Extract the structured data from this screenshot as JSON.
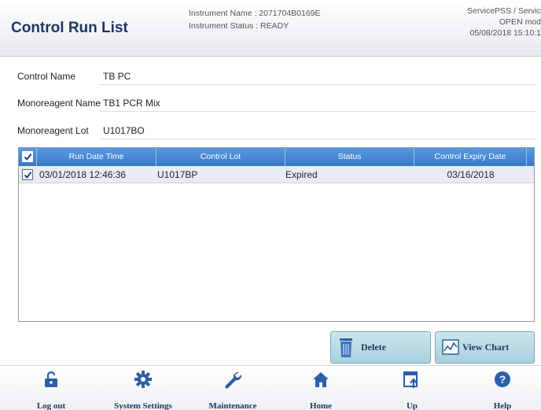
{
  "header": {
    "title": "Control Run List",
    "instrument_name": "Instrument Name : 2071704B0169E",
    "instrument_status": "Instrument Status : READY",
    "user": "ServicePSS / Servic",
    "mode": "OPEN mod",
    "datetime": "05/08/2018 15:10:1"
  },
  "fields": {
    "control_name_label": "Control Name",
    "control_name_value": "TB PC",
    "monoreagent_name_label": "Monoreagent Name",
    "monoreagent_name_value": "TB1 PCR Mix",
    "monoreagent_lot_label": "Monoreagent Lot",
    "monoreagent_lot_value": "U1017BO"
  },
  "table": {
    "columns": [
      "Run Date Time",
      "Control Lot",
      "Status",
      "Control Expiry Date"
    ],
    "rows": [
      {
        "checked": true,
        "run_date_time": "03/01/2018 12:46:36",
        "control_lot": "U1017BP",
        "status": "Expired",
        "expiry": "03/16/2018"
      }
    ]
  },
  "buttons": {
    "delete": "Delete",
    "view_chart": "View Chart"
  },
  "nav": {
    "logout": "Log out",
    "system_settings": "System Settings",
    "maintenance": "Maintenance",
    "home": "Home",
    "up": "Up",
    "help": "Help"
  },
  "colors": {
    "title": "#1f3763",
    "table_header": "#4a8ad6",
    "button": "#b8dbe6"
  }
}
